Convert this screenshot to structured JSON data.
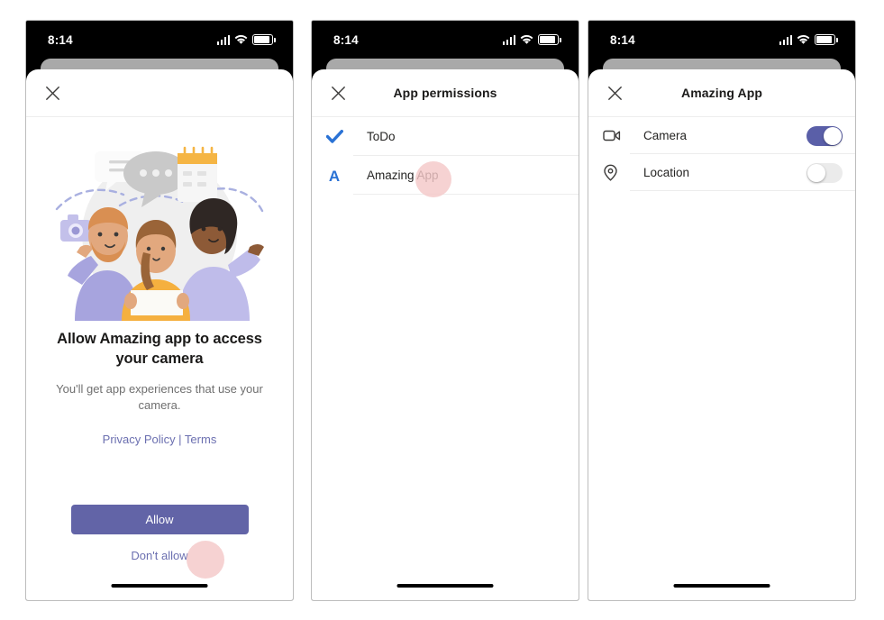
{
  "status_bar": {
    "time": "8:14",
    "signal_icon": "signal-bars-icon",
    "wifi_icon": "wifi-icon",
    "battery_icon": "battery-icon"
  },
  "panels": [
    {
      "id": "camera-permission-prompt",
      "header": {
        "close_icon": "close-icon",
        "title": ""
      },
      "illustration_name": "people-collaborating-illustration",
      "title": "Allow Amazing app to access your camera",
      "subtitle": "You'll get app experiences that use your camera.",
      "links_text": "Privacy Policy | Terms",
      "privacy_link": "Privacy Policy",
      "terms_link": "Terms",
      "primary_button": "Allow",
      "secondary_button": "Don't allow"
    },
    {
      "id": "app-permissions-list",
      "header": {
        "close_icon": "close-icon",
        "title": "App permissions"
      },
      "items": [
        {
          "label": "ToDo",
          "icon": "todo-checkmark-icon",
          "icon_color": "#2a72d5"
        },
        {
          "label": "Amazing App",
          "icon": "amazing-app-letter-a-icon",
          "icon_color": "#2a72d5"
        }
      ]
    },
    {
      "id": "amazing-app-permissions",
      "header": {
        "close_icon": "close-icon",
        "title": "Amazing App"
      },
      "items": [
        {
          "label": "Camera",
          "icon": "video-camera-icon",
          "toggle": "on"
        },
        {
          "label": "Location",
          "icon": "location-pin-icon",
          "toggle": "off"
        }
      ]
    }
  ],
  "colors": {
    "primary_purple": "#6264a7",
    "toggle_on": "#5a5fa8",
    "link_purple": "#6b6fb0",
    "accent_blue": "#2a72d5",
    "click_indicator": "#f4c8c8",
    "divider": "#ededed",
    "text_primary": "#252423",
    "text_secondary": "#6f6f6f"
  }
}
